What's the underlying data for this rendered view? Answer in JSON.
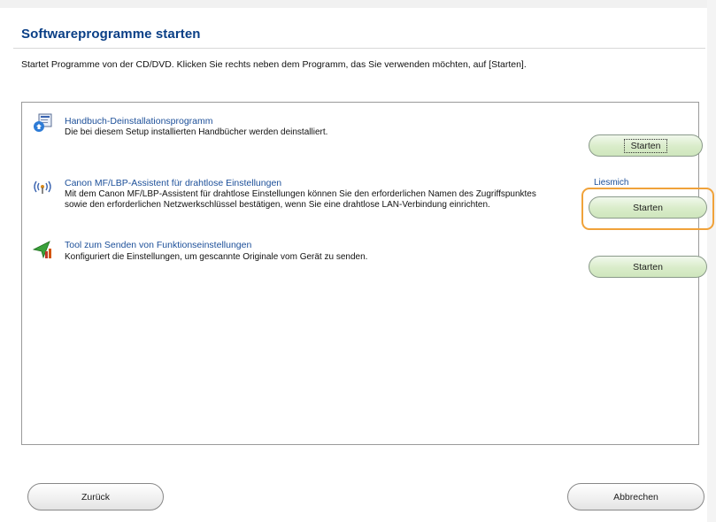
{
  "header": {
    "title": "Softwareprogramme starten",
    "instruction": "Startet Programme von der CD/DVD. Klicken Sie rechts neben dem Programm, das Sie verwenden möchten, auf [Starten]."
  },
  "programs": [
    {
      "name": "Handbuch-Deinstallationsprogramm",
      "description": "Die bei diesem Setup installierten Handbücher werden deinstalliert.",
      "button_label": "Starten",
      "icon": "uninstall-icon"
    },
    {
      "name": "Canon MF/LBP-Assistent für drahtlose Einstellungen",
      "description": "Mit dem Canon MF/LBP-Assistent für drahtlose Einstellungen können Sie den erforderlichen Namen des Zugriffspunktes sowie den erforderlichen Netzwerkschlüssel bestätigen, wenn Sie eine drahtlose LAN-Verbindung einrichten.",
      "button_label": "Starten",
      "readme_label": "Liesmich",
      "icon": "wireless-icon"
    },
    {
      "name": "Tool zum Senden von Funktionseinstellungen",
      "description": "Konfiguriert die Einstellungen, um gescannte Originale vom Gerät zu senden.",
      "button_label": "Starten",
      "icon": "send-tool-icon"
    }
  ],
  "footer": {
    "back_label": "Zurück",
    "cancel_label": "Abbrechen"
  },
  "colors": {
    "title": "#0a3f86",
    "link": "#1c4f99",
    "button_green": "#d9ecc9",
    "highlight": "#f0a23a"
  }
}
